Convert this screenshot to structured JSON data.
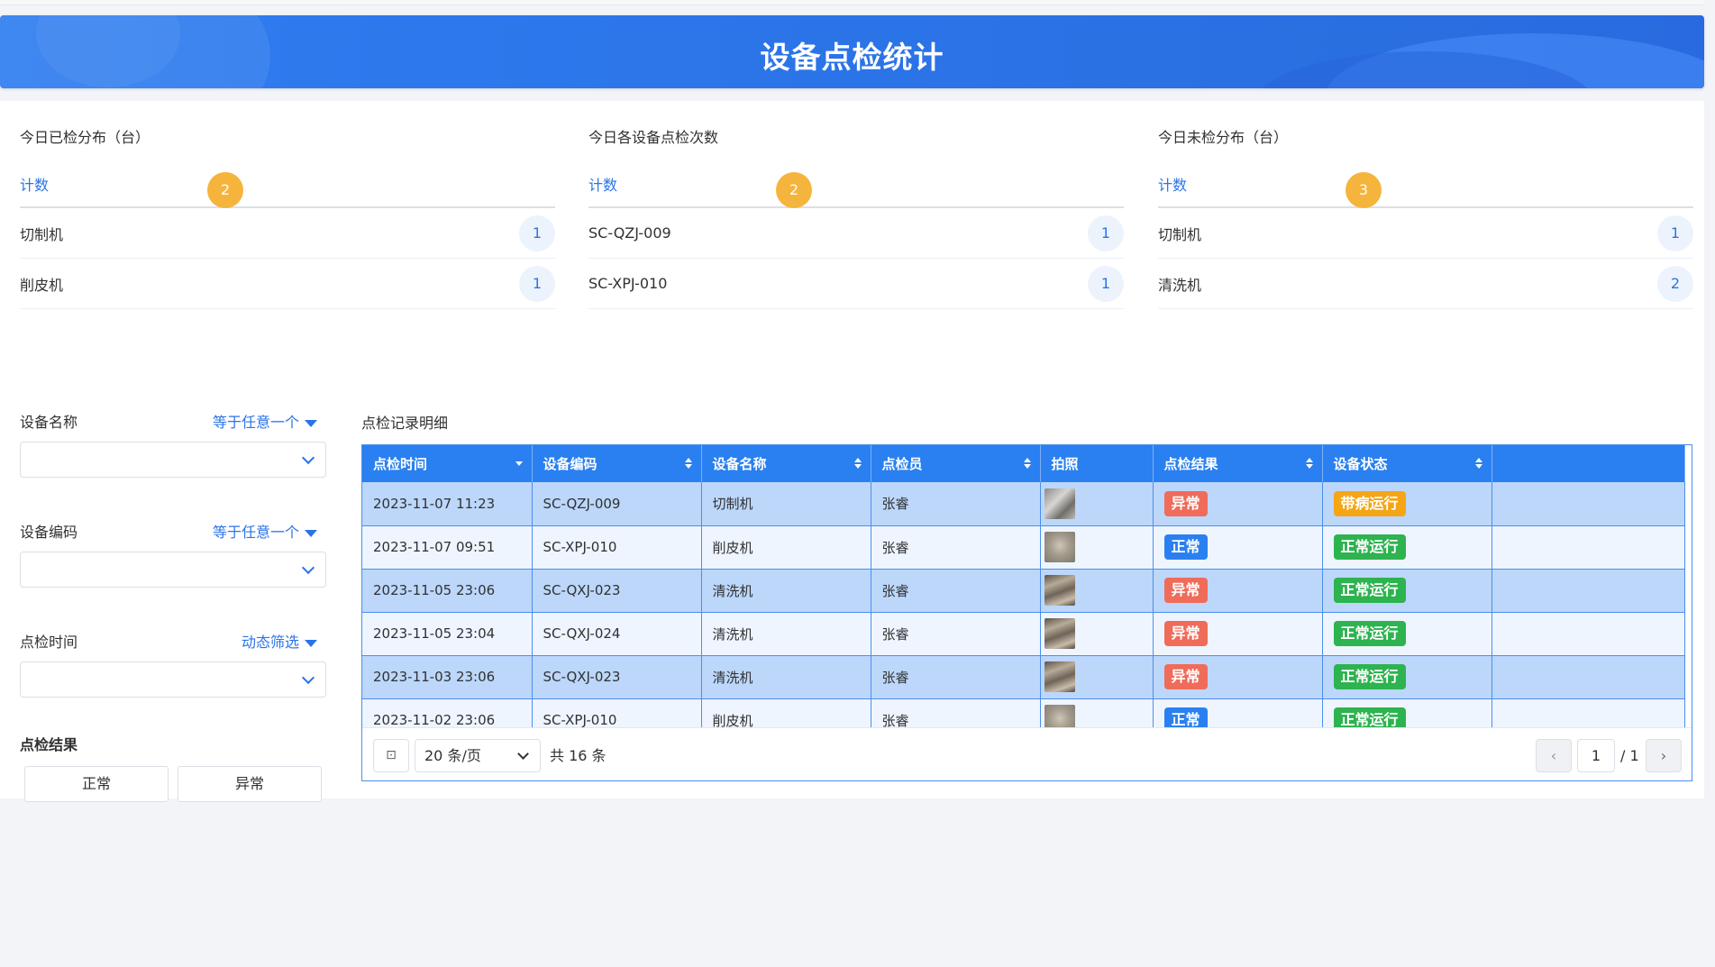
{
  "header": {
    "title": "设备点检统计"
  },
  "stats": [
    {
      "title": "今日已检分布（台）",
      "head_label": "计数",
      "total": "2",
      "rows": [
        {
          "label": "切制机",
          "value": "1"
        },
        {
          "label": "削皮机",
          "value": "1"
        }
      ]
    },
    {
      "title": "今日各设备点检次数",
      "head_label": "计数",
      "total": "2",
      "rows": [
        {
          "label": "SC-QZJ-009",
          "value": "1"
        },
        {
          "label": "SC-XPJ-010",
          "value": "1"
        }
      ]
    },
    {
      "title": "今日未检分布（台）",
      "head_label": "计数",
      "total": "3",
      "rows": [
        {
          "label": "切制机",
          "value": "1"
        },
        {
          "label": "清洗机",
          "value": "2"
        }
      ]
    }
  ],
  "filters": {
    "device_name": {
      "label": "设备名称",
      "mode": "等于任意一个",
      "value": ""
    },
    "device_code": {
      "label": "设备编码",
      "mode": "等于任意一个",
      "value": ""
    },
    "inspect_time": {
      "label": "点检时间",
      "mode": "动态筛选",
      "value": ""
    },
    "result": {
      "label": "点检结果",
      "options": [
        "正常",
        "异常"
      ]
    }
  },
  "detail": {
    "title": "点检记录明细",
    "columns": [
      "点检时间",
      "设备编码",
      "设备名称",
      "点检员",
      "拍照",
      "点检结果",
      "设备状态"
    ],
    "rows": [
      {
        "time": "2023-11-07 11:23",
        "code": "SC-QZJ-009",
        "name": "切制机",
        "inspector": "张睿",
        "result": "异常",
        "status": "带病运行"
      },
      {
        "time": "2023-11-07 09:51",
        "code": "SC-XPJ-010",
        "name": "削皮机",
        "inspector": "张睿",
        "result": "正常",
        "status": "正常运行"
      },
      {
        "time": "2023-11-05 23:06",
        "code": "SC-QXJ-023",
        "name": "清洗机",
        "inspector": "张睿",
        "result": "异常",
        "status": "正常运行"
      },
      {
        "time": "2023-11-05 23:04",
        "code": "SC-QXJ-024",
        "name": "清洗机",
        "inspector": "张睿",
        "result": "异常",
        "status": "正常运行"
      },
      {
        "time": "2023-11-03 23:06",
        "code": "SC-QXJ-023",
        "name": "清洗机",
        "inspector": "张睿",
        "result": "异常",
        "status": "正常运行"
      },
      {
        "time": "2023-11-02 23:06",
        "code": "SC-XPJ-010",
        "name": "削皮机",
        "inspector": "张睿",
        "result": "正常",
        "status": "正常运行"
      }
    ]
  },
  "pager": {
    "page_size": "20 条/页",
    "total": "共 16 条",
    "current": "1",
    "pages": "/ 1"
  },
  "colors": {
    "primary": "#2a80f0",
    "abnormal": "#f06b5a",
    "running": "#2db34f",
    "sick": "#f5a516",
    "total_badge": "#f5b43c"
  },
  "icons": {
    "first_page": "first-page-icon",
    "prev": "chevron-left-icon",
    "next": "chevron-right-icon"
  }
}
